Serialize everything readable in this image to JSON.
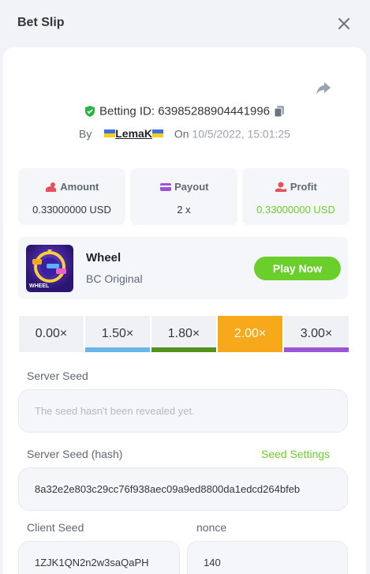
{
  "header": {
    "title": "Bet Slip"
  },
  "bet": {
    "id_label": "Betting ID:",
    "id": "63985288904441996",
    "by_label": "By",
    "user": "LemaK",
    "on_label": "On",
    "date": "10/5/2022, 15:01:25"
  },
  "stats": [
    {
      "label": "Amount",
      "value": "0.33000000 USD",
      "icon": "hand-coins-icon",
      "color": "#31373d"
    },
    {
      "label": "Payout",
      "value": "2 x",
      "icon": "wallet-card-icon",
      "color": "#31373d"
    },
    {
      "label": "Profit",
      "value": "0.33000000 USD",
      "icon": "profit-hand-icon",
      "color": "#6acf2b"
    }
  ],
  "game": {
    "name": "Wheel",
    "provider": "BC Original",
    "thumb_label": "WHEEL",
    "play_label": "Play Now"
  },
  "multipliers": [
    {
      "label": "0.00×",
      "color": "#f0f1f5",
      "active": false
    },
    {
      "label": "1.50×",
      "color": "#6ab7ea",
      "active": false
    },
    {
      "label": "1.80×",
      "color": "#53911d",
      "active": false
    },
    {
      "label": "2.00×",
      "color": "#f8a91b",
      "active": true
    },
    {
      "label": "3.00×",
      "color": "#9b55d6",
      "active": false
    }
  ],
  "server_seed": {
    "label": "Server Seed",
    "placeholder": "The seed hasn't been revealed yet."
  },
  "server_hash": {
    "label": "Server Seed (hash)",
    "settings_link": "Seed Settings",
    "value": "8a32e2e803c29cc76f938aec09a9ed8800da1edcd264bfeb"
  },
  "client_seed": {
    "label": "Client Seed",
    "value": "1ZJK1QN2n2w3saQaPH"
  },
  "nonce": {
    "label": "nonce",
    "value": "140"
  },
  "colors": {
    "accent_green": "#6acf2b",
    "active_orange": "#f8a91b"
  }
}
